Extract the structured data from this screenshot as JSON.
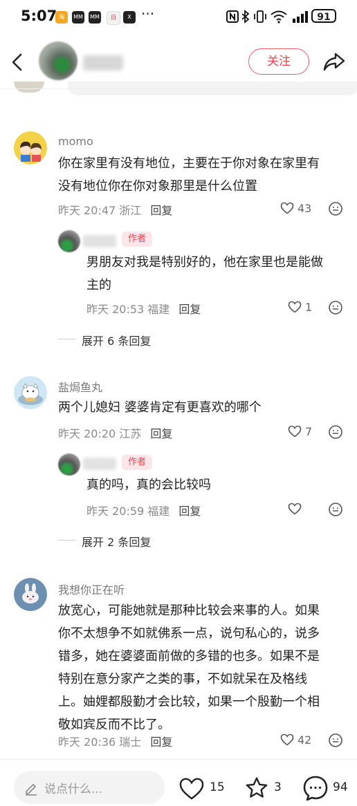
{
  "status_bar": {
    "time": "5:07",
    "apps": [
      "淘",
      "MM",
      "MM",
      "日",
      "X"
    ],
    "more": "···",
    "right_icons": [
      "nfc-icon",
      "bluetooth-icon",
      "vibrate-icon",
      "wifi-icon",
      "signal-icon"
    ],
    "battery": "91"
  },
  "header": {
    "follow_label": "关注"
  },
  "comments": [
    {
      "username": "momo",
      "text_lines": [
        "你在家里有没有地位，主要在于你对象在家里有",
        "没有地位你在你对象那里是什么位置"
      ],
      "time": "昨天 20:47",
      "location": "浙江",
      "reply_label": "回复",
      "likes": "43",
      "reply": {
        "tag": "作者",
        "text_lines": [
          "男朋友对我是特别好的，他在家里也是能做",
          "主的"
        ],
        "time": "昨天 20:53",
        "location": "福建",
        "reply_label": "回复",
        "likes": "1"
      },
      "expand": "展开 6 条回复"
    },
    {
      "username": "盐焗鱼丸",
      "text_lines": [
        "两个儿媳妇 婆婆肯定有更喜欢的哪个"
      ],
      "time": "昨天 20:20",
      "location": "江苏",
      "reply_label": "回复",
      "likes": "7",
      "reply": {
        "tag": "作者",
        "text_lines": [
          "真的吗，真的会比较吗"
        ],
        "time": "昨天 20:59",
        "location": "福建",
        "reply_label": "回复",
        "likes": ""
      },
      "expand": "展开 2 条回复"
    },
    {
      "username": "我想你正在听",
      "text_lines": [
        "放宽心，可能她就是那种比较会来事的人。如果",
        "你不太想争不如就佛系一点，说句私心的，说多",
        "错多，她在婆婆面前做的多错的也多。如果不是",
        "特别在意分家产之类的事，不如就呆在及格线",
        "上。妯娌都殷勤才会比较，如果一个殷勤一个相",
        "敬如宾反而不比了。"
      ],
      "time": "昨天 20:36",
      "location": "瑞士",
      "reply_label": "回复",
      "likes": "42"
    }
  ],
  "bottom_bar": {
    "input_placeholder": "说点什么...",
    "like_count": "15",
    "star_count": "3",
    "comment_count": "94"
  },
  "colors": {
    "accent": "#f0404f",
    "tag_bg": "#fde6e9",
    "meta": "#8a8a8a"
  }
}
